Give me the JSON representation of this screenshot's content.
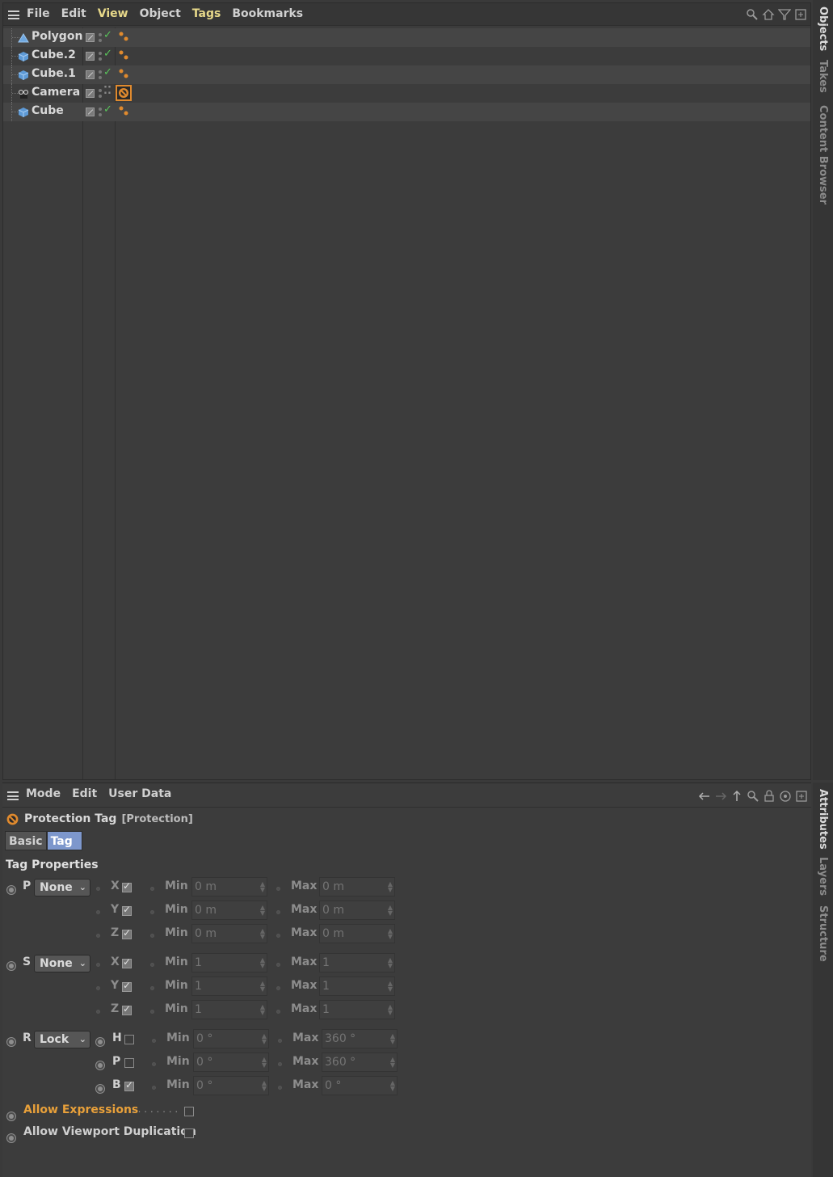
{
  "objects_manager": {
    "menu": [
      "File",
      "Edit",
      "View",
      "Object",
      "Tags",
      "Bookmarks"
    ],
    "toolbar_icons": [
      "search-icon",
      "home-icon",
      "filter-icon",
      "new-window-icon"
    ],
    "objects": [
      {
        "name": "Polygon",
        "icon": "polygon-icon",
        "check": "green",
        "tag": "phong"
      },
      {
        "name": "Cube.2",
        "icon": "cube-icon",
        "check": "green",
        "tag": "phong"
      },
      {
        "name": "Cube.1",
        "icon": "cube-icon",
        "check": "green",
        "tag": "phong"
      },
      {
        "name": "Camera",
        "icon": "camera-icon",
        "check": "gray",
        "tag": "protection"
      },
      {
        "name": "Cube",
        "icon": "cube-icon",
        "check": "green",
        "tag": "phong"
      }
    ],
    "side_tabs": [
      "Objects",
      "Takes",
      "Content Browser"
    ]
  },
  "attributes_manager": {
    "menu": [
      "Mode",
      "Edit",
      "User Data"
    ],
    "toolbar_icons": [
      "back-arrow-icon",
      "forward-arrow-icon",
      "up-arrow-icon",
      "search-icon",
      "lock-icon",
      "target-icon",
      "new-window-icon"
    ],
    "title": "Protection Tag",
    "subtitle": "[Protection]",
    "tabs": [
      "Basic",
      "Tag"
    ],
    "active_tab": "Tag",
    "section": "Tag Properties",
    "groups": [
      {
        "label": "P",
        "mode": "None",
        "rows": [
          {
            "axis": "X",
            "checked": true,
            "min": "0 m",
            "max": "0 m"
          },
          {
            "axis": "Y",
            "checked": true,
            "min": "0 m",
            "max": "0 m"
          },
          {
            "axis": "Z",
            "checked": true,
            "min": "0 m",
            "max": "0 m"
          }
        ]
      },
      {
        "label": "S",
        "mode": "None",
        "rows": [
          {
            "axis": "X",
            "checked": true,
            "min": "1",
            "max": "1"
          },
          {
            "axis": "Y",
            "checked": true,
            "min": "1",
            "max": "1"
          },
          {
            "axis": "Z",
            "checked": true,
            "min": "1",
            "max": "1"
          }
        ]
      },
      {
        "label": "R",
        "mode": "Lock",
        "rows": [
          {
            "axis": "H",
            "checked": false,
            "min": "0 °",
            "max": "360 °"
          },
          {
            "axis": "P",
            "checked": false,
            "min": "0 °",
            "max": "360 °"
          },
          {
            "axis": "B",
            "checked": true,
            "min": "0 °",
            "max": "0 °"
          }
        ]
      }
    ],
    "min_label": "Min",
    "max_label": "Max",
    "allow_expressions": {
      "label": "Allow Expressions",
      "leader": " . . . . . . . .",
      "checked": false
    },
    "allow_viewport_duplication": {
      "label": "Allow Viewport Duplication",
      "checked": false
    },
    "side_tabs": [
      "Attributes",
      "Layers",
      "Structure"
    ]
  },
  "colors": {
    "accent_orange": "#e8a03a",
    "active_tab": "#7d97cc",
    "check_green": "#59c45a",
    "menu_highlight": "#e8d98a"
  }
}
